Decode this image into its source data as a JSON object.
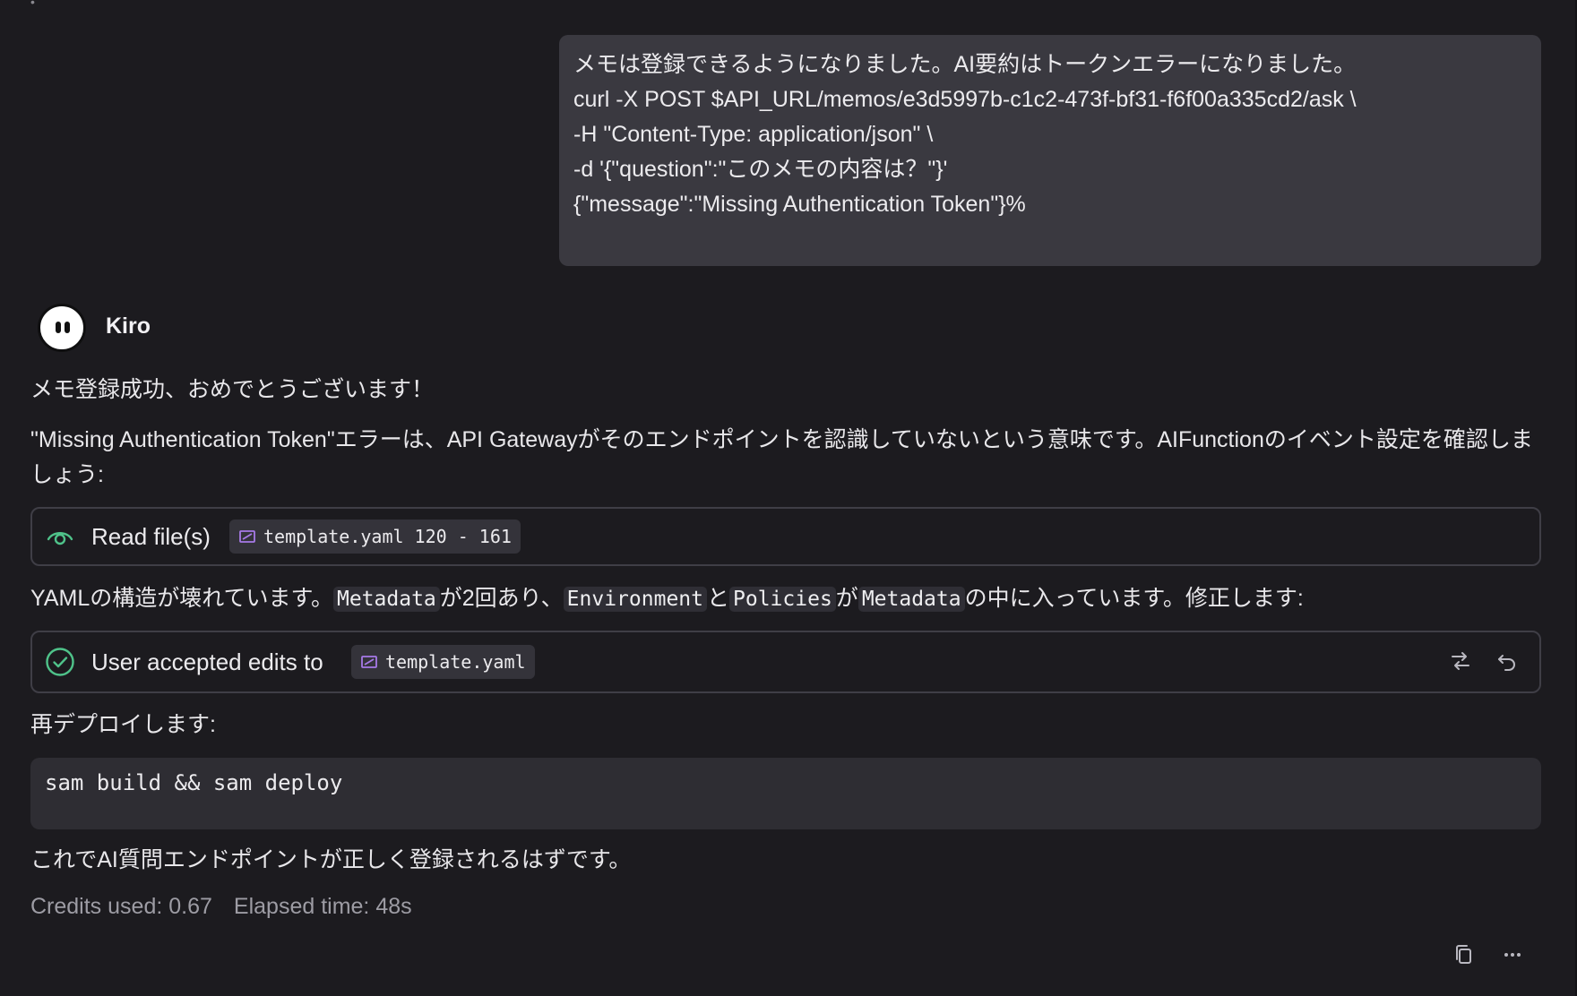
{
  "top_sliver": "•",
  "user_message": {
    "lines": [
      "メモは登録できるようになりました。AI要約はトークンエラーになりました。",
      "curl -X POST $API_URL/memos/e3d5997b-c1c2-473f-bf31-f6f00a335cd2/ask \\",
      "-H \"Content-Type: application/json\" \\",
      "-d '{\"question\":\"このメモの内容は？\"}'",
      "{\"message\":\"Missing Authentication Token\"}%"
    ]
  },
  "assistant": {
    "name": "Kiro",
    "para1": "メモ登録成功、おめでとうございます！",
    "para2": "\"Missing Authentication Token\"エラーは、API Gatewayがそのエンドポイントを認識していないという意味です。AIFunctionのイベント設定を確認しましょう:",
    "read_card": {
      "label": "Read file(s)",
      "file": "template.yaml",
      "range": "120 - 161",
      "icon": "eye-icon"
    },
    "para3": {
      "t1": "YAMLの構造が壊れています。",
      "c1": "Metadata",
      "t2": "が2回あり、",
      "c2": "Environment",
      "t3": "と",
      "c3": "Policies",
      "t4": "が",
      "c4": "Metadata",
      "t5": "の中に入っています。修正します:"
    },
    "edit_card": {
      "label": "User accepted edits to",
      "file": "template.yaml",
      "icon": "check-circle-icon",
      "actions": [
        "compare-icon",
        "undo-icon"
      ]
    },
    "para4": "再デプロイします:",
    "code": "sam build && sam deploy",
    "para5": "これでAI質問エンドポイントが正しく登録されるはずです。",
    "credits": "Credits used: 0.67",
    "elapsed": "Elapsed time: 48s"
  },
  "footer_actions": [
    "copy-icon",
    "more-icon"
  ],
  "colors": {
    "background": "#1c1b1f",
    "bubble": "#3a3940",
    "accent_green": "#4fc38a",
    "file_icon_purple": "#a77ae8"
  }
}
